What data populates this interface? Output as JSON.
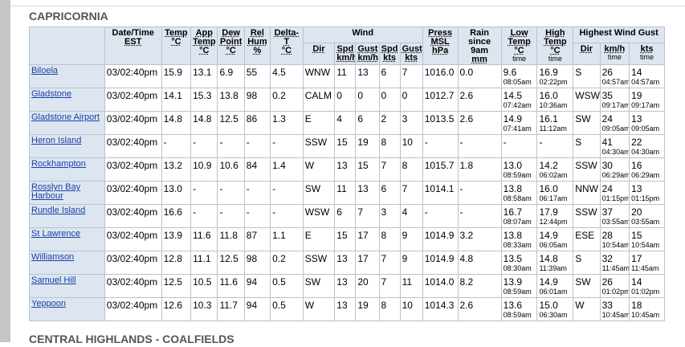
{
  "region_title": "CAPRICORNIA",
  "next_region_title": "CENTRAL HIGHLANDS - COALFIELDS",
  "headers": {
    "datetime": "Date/Time",
    "datetime_unit": "EST",
    "temp": "Temp",
    "temp_unit": "°C",
    "app_temp": "App Temp",
    "app_temp_unit": "°C",
    "dew": "Dew Point",
    "dew_unit": "°C",
    "hum": "Rel Hum",
    "hum_unit": "%",
    "delta": "Delta-T",
    "delta_unit": "°C",
    "wind": "Wind",
    "wind_dir": "Dir",
    "wind_spd": "Spd",
    "wind_spd_unit": "km/h",
    "wind_gust": "Gust",
    "wind_gust_unit": "km/h",
    "wind_spd_kts": "Spd",
    "wind_spd_kts_unit": "kts",
    "wind_gust_kts": "Gust",
    "wind_gust_kts_unit": "kts",
    "press": "Press MSL",
    "press_unit": "hPa",
    "rain": "Rain since 9am",
    "rain_unit": "mm",
    "low": "Low Temp",
    "low_unit": "°C",
    "low_time": "time",
    "high": "High Temp",
    "high_unit": "°C",
    "high_time": "time",
    "hwg": "Highest Wind Gust",
    "hwg_dir": "Dir",
    "hwg_kmh": "km/h",
    "hwg_kmh_time": "time",
    "hwg_kts": "kts",
    "hwg_kts_time": "time"
  },
  "rows": [
    {
      "station": "Biloela",
      "dt": "03/02:40pm",
      "temp": "15.9",
      "app": "13.1",
      "dew": "6.9",
      "hum": "55",
      "delta": "4.5",
      "dir": "WNW",
      "spd": "11",
      "gust": "13",
      "spdk": "6",
      "gustk": "7",
      "press": "1016.0",
      "rain": "0.0",
      "low": "9.6",
      "low_t": "08:05am",
      "high": "16.9",
      "high_t": "02:22pm",
      "gdir": "S",
      "gkmh": "26",
      "gkmh_t": "04:57am",
      "gkts": "14",
      "gkts_t": "04:57am"
    },
    {
      "station": "Gladstone",
      "dt": "03/02:40pm",
      "temp": "14.1",
      "app": "15.3",
      "dew": "13.8",
      "hum": "98",
      "delta": "0.2",
      "dir": "CALM",
      "spd": "0",
      "gust": "0",
      "spdk": "0",
      "gustk": "0",
      "press": "1012.7",
      "rain": "2.6",
      "low": "14.5",
      "low_t": "07:42am",
      "high": "16.0",
      "high_t": "10:36am",
      "gdir": "WSW",
      "gkmh": "35",
      "gkmh_t": "09:17am",
      "gkts": "19",
      "gkts_t": "09:17am"
    },
    {
      "station": "Gladstone Airport",
      "dt": "03/02:40pm",
      "temp": "14.8",
      "app": "14.8",
      "dew": "12.5",
      "hum": "86",
      "delta": "1.3",
      "dir": "E",
      "spd": "4",
      "gust": "6",
      "spdk": "2",
      "gustk": "3",
      "press": "1013.5",
      "rain": "2.6",
      "low": "14.9",
      "low_t": "07:41am",
      "high": "16.1",
      "high_t": "11:12am",
      "gdir": "SW",
      "gkmh": "24",
      "gkmh_t": "09:05am",
      "gkts": "13",
      "gkts_t": "09:05am"
    },
    {
      "station": "Heron Island",
      "dt": "03/02:40pm",
      "temp": "-",
      "app": "-",
      "dew": "-",
      "hum": "-",
      "delta": "-",
      "dir": "SSW",
      "spd": "15",
      "gust": "19",
      "spdk": "8",
      "gustk": "10",
      "press": "-",
      "rain": "-",
      "low": "-",
      "low_t": "",
      "high": "-",
      "high_t": "",
      "gdir": "S",
      "gkmh": "41",
      "gkmh_t": "04:30am",
      "gkts": "22",
      "gkts_t": "04:30am"
    },
    {
      "station": "Rockhampton",
      "dt": "03/02:40pm",
      "temp": "13.2",
      "app": "10.9",
      "dew": "10.6",
      "hum": "84",
      "delta": "1.4",
      "dir": "W",
      "spd": "13",
      "gust": "15",
      "spdk": "7",
      "gustk": "8",
      "press": "1015.7",
      "rain": "1.8",
      "low": "13.0",
      "low_t": "08:59am",
      "high": "14.2",
      "high_t": "06:02am",
      "gdir": "SSW",
      "gkmh": "30",
      "gkmh_t": "06:29am",
      "gkts": "16",
      "gkts_t": "06:29am"
    },
    {
      "station": "Rosslyn Bay Harbour",
      "dt": "03/02:40pm",
      "temp": "13.0",
      "app": "-",
      "dew": "-",
      "hum": "-",
      "delta": "-",
      "dir": "SW",
      "spd": "11",
      "gust": "13",
      "spdk": "6",
      "gustk": "7",
      "press": "1014.1",
      "rain": "-",
      "low": "13.8",
      "low_t": "08:58am",
      "high": "16.0",
      "high_t": "06:17am",
      "gdir": "NNW",
      "gkmh": "24",
      "gkmh_t": "01:15pm",
      "gkts": "13",
      "gkts_t": "01:15pm"
    },
    {
      "station": "Rundle Island",
      "dt": "03/02:40pm",
      "temp": "16.6",
      "app": "-",
      "dew": "-",
      "hum": "-",
      "delta": "-",
      "dir": "WSW",
      "spd": "6",
      "gust": "7",
      "spdk": "3",
      "gustk": "4",
      "press": "-",
      "rain": "-",
      "low": "16.7",
      "low_t": "08:07am",
      "high": "17.9",
      "high_t": "12:44pm",
      "gdir": "SSW",
      "gkmh": "37",
      "gkmh_t": "03:55am",
      "gkts": "20",
      "gkts_t": "03:55am"
    },
    {
      "station": "St Lawrence",
      "dt": "03/02:40pm",
      "temp": "13.9",
      "app": "11.6",
      "dew": "11.8",
      "hum": "87",
      "delta": "1.1",
      "dir": "E",
      "spd": "15",
      "gust": "17",
      "spdk": "8",
      "gustk": "9",
      "press": "1014.9",
      "rain": "3.2",
      "low": "13.8",
      "low_t": "08:33am",
      "high": "14.9",
      "high_t": "06:05am",
      "gdir": "ESE",
      "gkmh": "28",
      "gkmh_t": "10:54am",
      "gkts": "15",
      "gkts_t": "10:54am"
    },
    {
      "station": "Williamson",
      "dt": "03/02:40pm",
      "temp": "12.8",
      "app": "11.1",
      "dew": "12.5",
      "hum": "98",
      "delta": "0.2",
      "dir": "SSW",
      "spd": "13",
      "gust": "17",
      "spdk": "7",
      "gustk": "9",
      "press": "1014.9",
      "rain": "4.8",
      "low": "13.5",
      "low_t": "08:30am",
      "high": "14.8",
      "high_t": "11:39am",
      "gdir": "S",
      "gkmh": "32",
      "gkmh_t": "11:45am",
      "gkts": "17",
      "gkts_t": "11:45am"
    },
    {
      "station": "Samuel Hill",
      "dt": "03/02:40pm",
      "temp": "12.5",
      "app": "10.5",
      "dew": "11.6",
      "hum": "94",
      "delta": "0.5",
      "dir": "SW",
      "spd": "13",
      "gust": "20",
      "spdk": "7",
      "gustk": "11",
      "press": "1014.0",
      "rain": "8.2",
      "low": "13.9",
      "low_t": "08:59am",
      "high": "14.9",
      "high_t": "06:01am",
      "gdir": "SW",
      "gkmh": "26",
      "gkmh_t": "01:02pm",
      "gkts": "14",
      "gkts_t": "01:02pm"
    },
    {
      "station": "Yeppoon",
      "dt": "03/02:40pm",
      "temp": "12.6",
      "app": "10.3",
      "dew": "11.7",
      "hum": "94",
      "delta": "0.5",
      "dir": "W",
      "spd": "13",
      "gust": "19",
      "spdk": "8",
      "gustk": "10",
      "press": "1014.3",
      "rain": "2.6",
      "low": "13.6",
      "low_t": "08:59am",
      "high": "15.0",
      "high_t": "06:30am",
      "gdir": "W",
      "gkmh": "33",
      "gkmh_t": "10:45am",
      "gkts": "18",
      "gkts_t": "10:45am"
    }
  ]
}
